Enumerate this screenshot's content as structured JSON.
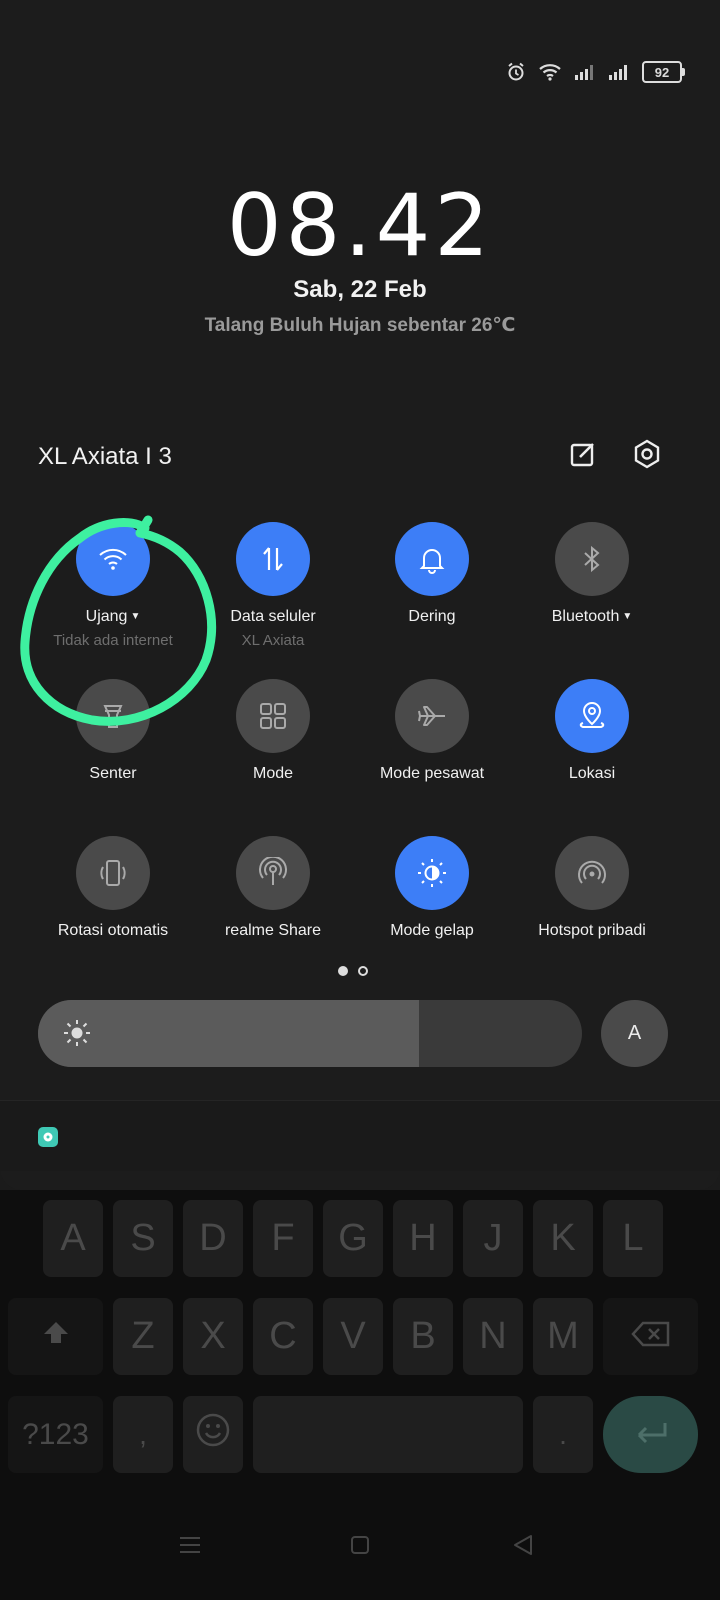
{
  "status_bar": {
    "battery_level": "92",
    "icons": [
      "alarm-icon",
      "wifi-icon",
      "signal-icon",
      "signal-icon"
    ]
  },
  "lock_info": {
    "time": "08.42",
    "date": "Sab, 22 Feb",
    "weather": "Talang Buluh Hujan sebentar 26℃"
  },
  "quick_panel": {
    "carrier": "XL Axiata I 3",
    "edit_icon": "edit-icon",
    "settings_icon": "gear-icon",
    "tiles": [
      {
        "label": "Ujang",
        "sub": "Tidak ada internet",
        "on": true,
        "icon": "wifi-icon",
        "caret": true
      },
      {
        "label": "Data seluler",
        "sub": "XL Axiata",
        "on": true,
        "icon": "data-arrows-icon"
      },
      {
        "label": "Dering",
        "on": true,
        "icon": "bell-icon"
      },
      {
        "label": "Bluetooth",
        "on": false,
        "icon": "bluetooth-icon",
        "caret": true
      },
      {
        "label": "Senter",
        "on": false,
        "icon": "flashlight-icon"
      },
      {
        "label": "Mode",
        "on": false,
        "icon": "grid-icon"
      },
      {
        "label": "Mode pesawat",
        "on": false,
        "icon": "airplane-icon"
      },
      {
        "label": "Lokasi",
        "on": true,
        "icon": "location-icon"
      },
      {
        "label": "Rotasi otomatis",
        "on": false,
        "icon": "rotate-icon"
      },
      {
        "label": "realme Share",
        "on": false,
        "icon": "share-antenna-icon"
      },
      {
        "label": "Mode gelap",
        "on": true,
        "icon": "dark-mode-icon"
      },
      {
        "label": "Hotspot pribadi",
        "on": false,
        "icon": "hotspot-icon"
      }
    ],
    "page_index": 1,
    "page_count": 2,
    "brightness_level": 0.7,
    "auto_brightness_label": "A"
  },
  "notification": {
    "app_icon": "chat-app-icon"
  },
  "keyboard": {
    "row2": [
      "A",
      "S",
      "D",
      "F",
      "G",
      "H",
      "J",
      "K",
      "L"
    ],
    "row3": [
      "Z",
      "X",
      "C",
      "V",
      "B",
      "N",
      "M"
    ],
    "symbols_label": "?123",
    "comma_label": ",",
    "period_label": ".",
    "emoji_icon": "emoji-icon",
    "shift_icon": "shift-icon",
    "backspace_icon": "backspace-icon",
    "enter_icon": "enter-icon"
  },
  "nav": {
    "icons": [
      "menu-icon",
      "home-icon",
      "back-icon"
    ]
  },
  "annotation": {
    "color": "#3ef0a0"
  }
}
